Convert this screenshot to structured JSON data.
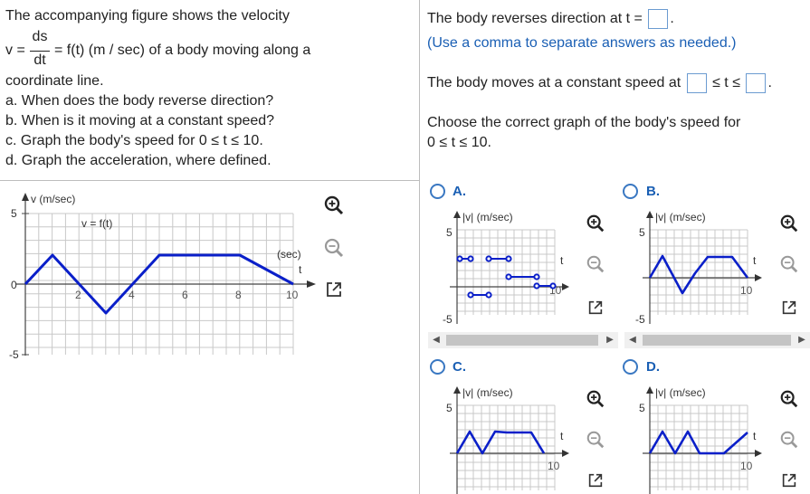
{
  "left": {
    "intro": "The accompanying figure shows the velocity",
    "v_eq_left": "v =",
    "frac_num": "ds",
    "frac_den": "dt",
    "v_eq_right": "= f(t) (m / sec) of a body moving along a",
    "line3": "coordinate line.",
    "parts": [
      "a. When does the body reverse direction?",
      "b. When is it moving at a constant speed?",
      "c. Graph the body's speed for 0 ≤ t ≤ 10.",
      "d. Graph the acceleration, where defined."
    ],
    "graph": {
      "ylabel": "v (m/sec)",
      "curve_label": "v = f(t)",
      "unit_label": "(sec)",
      "xvar": "t",
      "yticks": [
        "5",
        "0",
        "-5"
      ],
      "xticks": [
        "2",
        "4",
        "6",
        "8",
        "10"
      ]
    }
  },
  "right": {
    "reverse_prefix": "The body reverses direction at t =",
    "reverse_suffix": ".",
    "comma_hint": "(Use a comma to separate answers as needed.)",
    "constant_prefix": "The body moves at a constant speed at",
    "constant_mid": "≤ t ≤",
    "constant_suffix": ".",
    "choose_line1": "Choose the correct graph of the body's speed for",
    "choose_line2": "0 ≤ t ≤ 10.",
    "options": [
      {
        "letter": "A.",
        "ylabel": "|v| (m/sec)",
        "ytick_top": "5",
        "ytick_bottom": "-5",
        "xvar": "t",
        "xtick": "10"
      },
      {
        "letter": "B.",
        "ylabel": "|v| (m/sec)",
        "ytick_top": "5",
        "ytick_bottom": "-5",
        "xvar": "t",
        "xtick": "10"
      },
      {
        "letter": "C.",
        "ylabel": "|v| (m/sec)",
        "ytick_top": "5",
        "xvar": "t",
        "xtick": "10"
      },
      {
        "letter": "D.",
        "ylabel": "|v| (m/sec)",
        "ytick_top": "5",
        "xvar": "t",
        "xtick": "10"
      }
    ]
  },
  "colors": {
    "accent": "#1a5fb4",
    "curve": "#0a1fc9",
    "grid": "#c8c8c8"
  }
}
